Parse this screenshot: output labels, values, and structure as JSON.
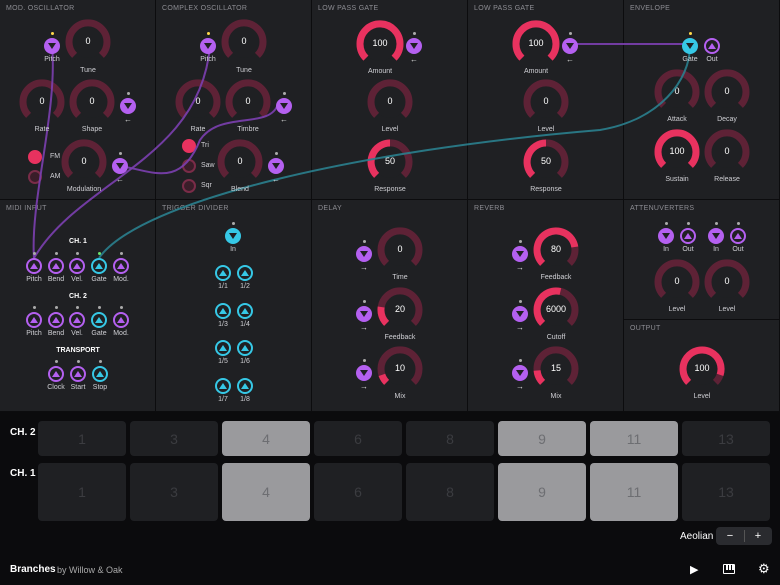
{
  "panels": {
    "mod_osc": "MOD. OSCILLATOR",
    "complex_osc": "COMPLEX OSCILLATOR",
    "lpg1": "LOW PASS GATE",
    "lpg2": "LOW PASS GATE",
    "envelope": "ENVELOPE",
    "midi": "MIDI INPUT",
    "trigger": "TRIGGER DIVIDER",
    "delay": "DELAY",
    "reverb": "REVERB",
    "attenuverters": "ATTENUVERTERS",
    "output": "OUTPUT"
  },
  "knobs": {
    "mod_tune": {
      "value": "0",
      "label": "Tune"
    },
    "mod_rate": {
      "value": "0",
      "label": "Rate"
    },
    "mod_shape": {
      "value": "0",
      "label": "Shape"
    },
    "mod_modulation": {
      "value": "0",
      "label": "Modulation"
    },
    "cx_tune": {
      "value": "0",
      "label": "Tune"
    },
    "cx_rate": {
      "value": "0",
      "label": "Rate"
    },
    "cx_timbre": {
      "value": "0",
      "label": "Timbre"
    },
    "cx_blend": {
      "value": "0",
      "label": "Blend"
    },
    "lpg1_amount": {
      "value": "100",
      "label": "Amount"
    },
    "lpg1_level": {
      "value": "0",
      "label": "Level"
    },
    "lpg1_response": {
      "value": "50",
      "label": "Response"
    },
    "lpg2_amount": {
      "value": "100",
      "label": "Amount"
    },
    "lpg2_level": {
      "value": "0",
      "label": "Level"
    },
    "lpg2_response": {
      "value": "50",
      "label": "Response"
    },
    "env_attack": {
      "value": "0",
      "label": "Attack"
    },
    "env_decay": {
      "value": "0",
      "label": "Decay"
    },
    "env_sustain": {
      "value": "100",
      "label": "Sustain"
    },
    "env_release": {
      "value": "0",
      "label": "Release"
    },
    "delay_time": {
      "value": "0",
      "label": "Time"
    },
    "delay_feedback": {
      "value": "20",
      "label": "Feedback"
    },
    "delay_mix": {
      "value": "10",
      "label": "Mix"
    },
    "rev_feedback": {
      "value": "80",
      "label": "Feedback"
    },
    "rev_cutoff": {
      "value": "6000",
      "label": "Cutoff"
    },
    "rev_mix": {
      "value": "15",
      "label": "Mix"
    },
    "att_level1": {
      "value": "0",
      "label": "Level"
    },
    "att_level2": {
      "value": "0",
      "label": "Level"
    },
    "out_level": {
      "value": "100",
      "label": "Level"
    }
  },
  "labels": {
    "pitch": "Pitch",
    "gate": "Gate",
    "out": "Out",
    "in": "In",
    "fm": "FM",
    "am": "AM",
    "tri": "Tri",
    "saw": "Saw",
    "sqr": "Sqr",
    "ch1": "CH. 1",
    "ch2": "CH. 2",
    "transport": "TRANSPORT",
    "bend": "Bend",
    "vel": "Vel.",
    "mod": "Mod.",
    "clock": "Clock",
    "start": "Start",
    "stop": "Stop",
    "d11": "1/1",
    "d12": "1/2",
    "d13": "1/3",
    "d14": "1/4",
    "d15": "1/5",
    "d16": "1/6",
    "d17": "1/7",
    "d18": "1/8",
    "arrow": "←",
    "arrow_r": "→"
  },
  "sequencer": {
    "ch2_label": "CH. 2",
    "ch1_label": "CH. 1",
    "cells": [
      "1",
      "3",
      "4",
      "6",
      "8",
      "9",
      "11",
      "13"
    ],
    "active_ch2": [
      false,
      false,
      true,
      false,
      false,
      true,
      true,
      false
    ],
    "active_ch1": [
      false,
      false,
      true,
      false,
      false,
      true,
      true,
      false
    ],
    "scale": "Aeolian",
    "minus": "−",
    "plus": "+"
  },
  "footer": {
    "app": "Branches",
    "by": "by Willow & Oak",
    "play": "▶",
    "gear": "⚙"
  },
  "colors": {
    "accent": "#e8325f",
    "port": "#b460f0",
    "port_gate": "#36c8e6",
    "cable_purple": "#7b3fb0",
    "cable_blue": "#2a7f8e"
  }
}
